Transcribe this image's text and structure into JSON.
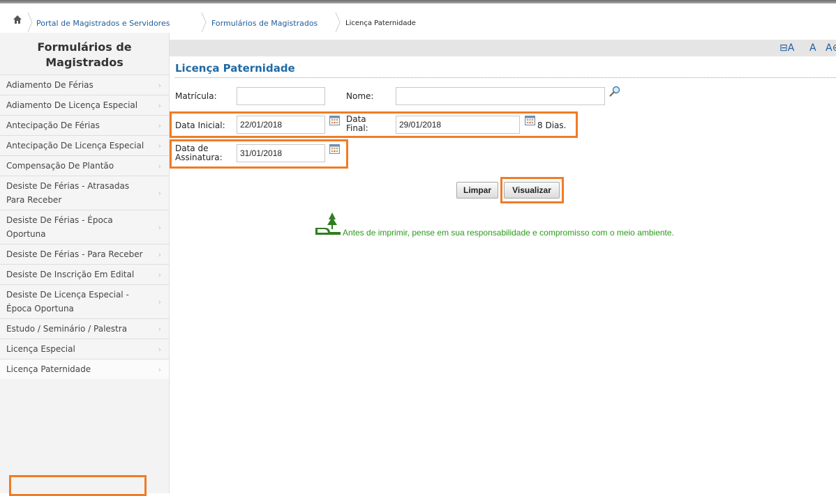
{
  "breadcrumb": {
    "items": [
      "Portal de Magistrados e Servidores",
      "Formulários de Magistrados"
    ],
    "current": "Licença Paternidade"
  },
  "sidebar": {
    "title": "Formulários de Magistrados",
    "items": [
      "Adiamento De Férias",
      "Adiamento De Licença Especial",
      "Antecipação De Férias",
      "Antecipação De Licença Especial",
      "Compensação De Plantão",
      "Desiste De Férias - Atrasadas Para Receber",
      "Desiste De Férias - Época Oportuna",
      "Desiste De Férias - Para Receber",
      "Desiste De Inscrição Em Edital",
      "Desiste De Licença Especial - Época Oportuna",
      "Estudo / Seminário / Palestra",
      "Licença Especial",
      "Licença Paternidade"
    ],
    "active_item": "Licença Paternidade"
  },
  "toolbar": {
    "decrease": "⊟A",
    "normal": "A",
    "increase": "A⊕"
  },
  "form": {
    "title": "Licença Paternidade",
    "matricula_label": "Matrícula:",
    "matricula_value": "",
    "nome_label": "Nome:",
    "nome_value": "",
    "data_inicial_label": "Data Inicial:",
    "data_inicial_value": "22/01/2018",
    "data_final_label_1": "Data",
    "data_final_label_2": "Final:",
    "data_final_value": "29/01/2018",
    "dias_text": "8 Dias.",
    "data_assinatura_label_1": "Data de",
    "data_assinatura_label_2": "Assinatura:",
    "data_assinatura_value": "31/01/2018",
    "clear_button": "Limpar",
    "view_button": "Visualizar"
  },
  "eco_message": "Antes de imprimir, pense em sua responsabilidade e compromisso com o meio ambiente.",
  "colors": {
    "highlight": "#f07c26",
    "link": "#1f5d9a",
    "heading": "#1f6aa5",
    "eco": "#2a9a1a"
  },
  "icons": [
    "home-icon",
    "calendar-icon",
    "search-icon",
    "eco-tree-icon",
    "chevron-right-icon"
  ]
}
